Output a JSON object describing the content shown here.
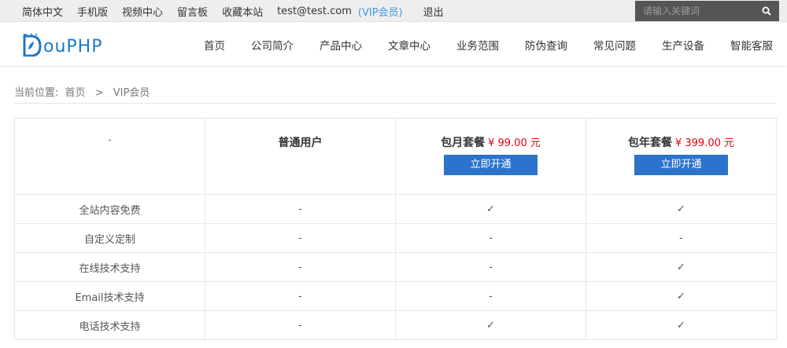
{
  "topbar": {
    "links": [
      "简体中文",
      "手机版",
      "视频中心",
      "留言板",
      "收藏本站"
    ],
    "user_email": "test@test.com",
    "vip_label": "(VIP会员)",
    "logout": "退出",
    "search_placeholder": "请输入关键词"
  },
  "logo": {
    "text": "ouPHP"
  },
  "nav": [
    "首页",
    "公司简介",
    "产品中心",
    "文章中心",
    "业务范围",
    "防伪查询",
    "常见问题",
    "生产设备",
    "智能客服"
  ],
  "breadcrumb": {
    "label": "当前位置:",
    "home": "首页",
    "sep": ">",
    "current": "VIP会员"
  },
  "table": {
    "corner": "-",
    "plans": [
      {
        "name": "普通用户",
        "price": "",
        "button": ""
      },
      {
        "name": "包月套餐",
        "price": "¥ 99.00 元",
        "button": "立即开通"
      },
      {
        "name": "包年套餐",
        "price": "¥ 399.00 元",
        "button": "立即开通"
      }
    ],
    "rows": [
      {
        "feature": "全站内容免费",
        "values": [
          "-",
          "✓",
          "✓"
        ]
      },
      {
        "feature": "自定义定制",
        "values": [
          "-",
          "-",
          "-"
        ]
      },
      {
        "feature": "在线技术支持",
        "values": [
          "-",
          "-",
          "✓"
        ]
      },
      {
        "feature": "Email技术支持",
        "values": [
          "-",
          "-",
          "✓"
        ]
      },
      {
        "feature": "电话技术支持",
        "values": [
          "-",
          "✓",
          "✓"
        ]
      }
    ]
  },
  "colors": {
    "accent": "#2c73cc",
    "price": "#e60012",
    "vip": "#3a9be0",
    "logo": "#1d79c9"
  }
}
